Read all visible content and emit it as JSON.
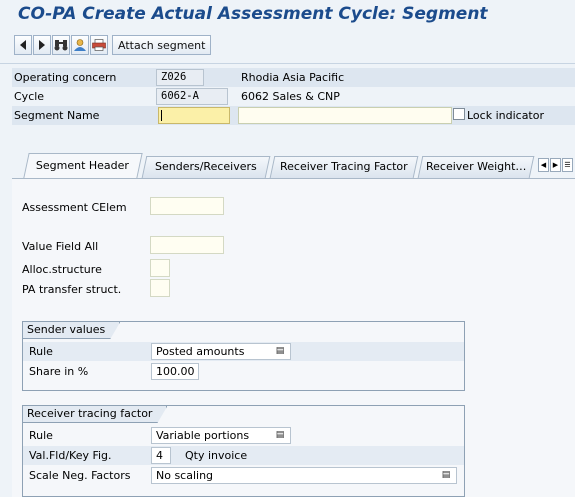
{
  "title": "CO-PA Create Actual Assessment Cycle: Segment",
  "toolbar": {
    "prev_icon": "arrow-left-icon",
    "next_icon": "arrow-right-icon",
    "find_icon": "binoculars-icon",
    "user_icon": "person-icon",
    "print_icon": "printer-icon",
    "attach_segment": "Attach segment"
  },
  "header": {
    "operating_concern": {
      "label": "Operating concern",
      "value": "Z026",
      "text": "Rhodia Asia Pacific"
    },
    "cycle": {
      "label": "Cycle",
      "value": "6062-A",
      "text": "6062 Sales & CNP"
    },
    "segment_name": {
      "label": "Segment Name",
      "value": "",
      "description": "",
      "lock_label": "Lock indicator",
      "lock_checked": false
    }
  },
  "tabs": [
    {
      "label": "Segment Header",
      "active": true
    },
    {
      "label": "Senders/Receivers"
    },
    {
      "label": "Receiver Tracing Factor"
    },
    {
      "label": "Receiver Weight…"
    }
  ],
  "segment_header": {
    "assessment_celem": {
      "label": "Assessment CElem",
      "value": ""
    },
    "value_field_all": {
      "label": "Value Field All",
      "value": ""
    },
    "alloc_structure": {
      "label": "Alloc.structure",
      "value": ""
    },
    "pa_transfer_struct": {
      "label": "PA transfer struct.",
      "value": ""
    }
  },
  "sender_values": {
    "title": "Sender values",
    "rule": {
      "label": "Rule",
      "value": "Posted amounts"
    },
    "share": {
      "label": "Share in %",
      "value": "100.00"
    }
  },
  "receiver_tracing": {
    "title": "Receiver tracing factor",
    "rule": {
      "label": "Rule",
      "value": "Variable portions"
    },
    "val_fld": {
      "label": "Val.Fld/Key Fig.",
      "value": "4",
      "text": "Qty invoice"
    },
    "scale": {
      "label": "Scale Neg. Factors",
      "value": "No scaling"
    }
  },
  "colors": {
    "title": "#1b4b8c",
    "required_field": "#fbf0a8",
    "background": "#eef3f8"
  }
}
